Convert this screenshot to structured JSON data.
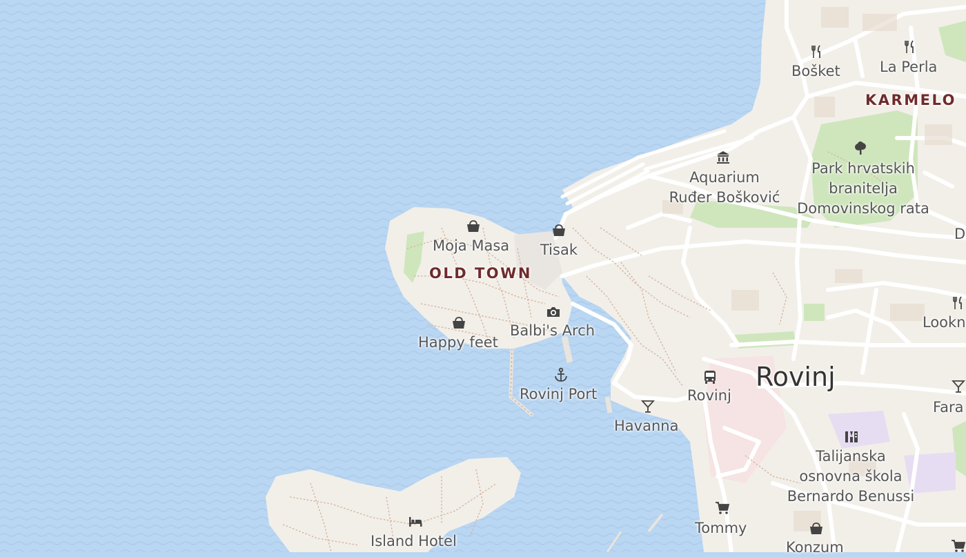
{
  "colors": {
    "water": "#b9d6f2",
    "land": "#f2efe9",
    "park": "#cfe6bd",
    "district_label": "#6f2b2b",
    "poi_icon": "#444444"
  },
  "labels": {
    "karmelo": "KARMELO",
    "old_town": "OLD TOWN",
    "rovinj_city": "Rovinj",
    "bosket": "Bošket",
    "la_perla": "La Perla",
    "aquarium_l1": "Aquarium",
    "aquarium_l2": "Ruđer Bošković",
    "park_l1": "Park hrvatskih",
    "park_l2": "branitelja",
    "park_l3": "Domovinskog rata",
    "moja_masa": "Moja Masa",
    "tisak": "Tisak",
    "balbis_arch": "Balbi's Arch",
    "happy_feet": "Happy feet",
    "rovinj_port": "Rovinj Port",
    "rovinj_bus": "Rovinj",
    "havanna": "Havanna",
    "school_l1": "Talijanska",
    "school_l2": "osnovna škola",
    "school_l3": "Bernardo Benussi",
    "tommy": "Tommy",
    "konzum": "Konzum",
    "island_hotel": "Island Hotel",
    "lookn": "Lookn",
    "fara": "Fara",
    "edge_d": "D"
  },
  "icons": [
    "restaurant-icon",
    "museum-icon",
    "park-tree-icon",
    "shop-bag-icon",
    "camera-icon",
    "anchor-icon",
    "bus-icon",
    "cocktail-icon",
    "school-icon",
    "cart-icon",
    "hotel-icon"
  ]
}
